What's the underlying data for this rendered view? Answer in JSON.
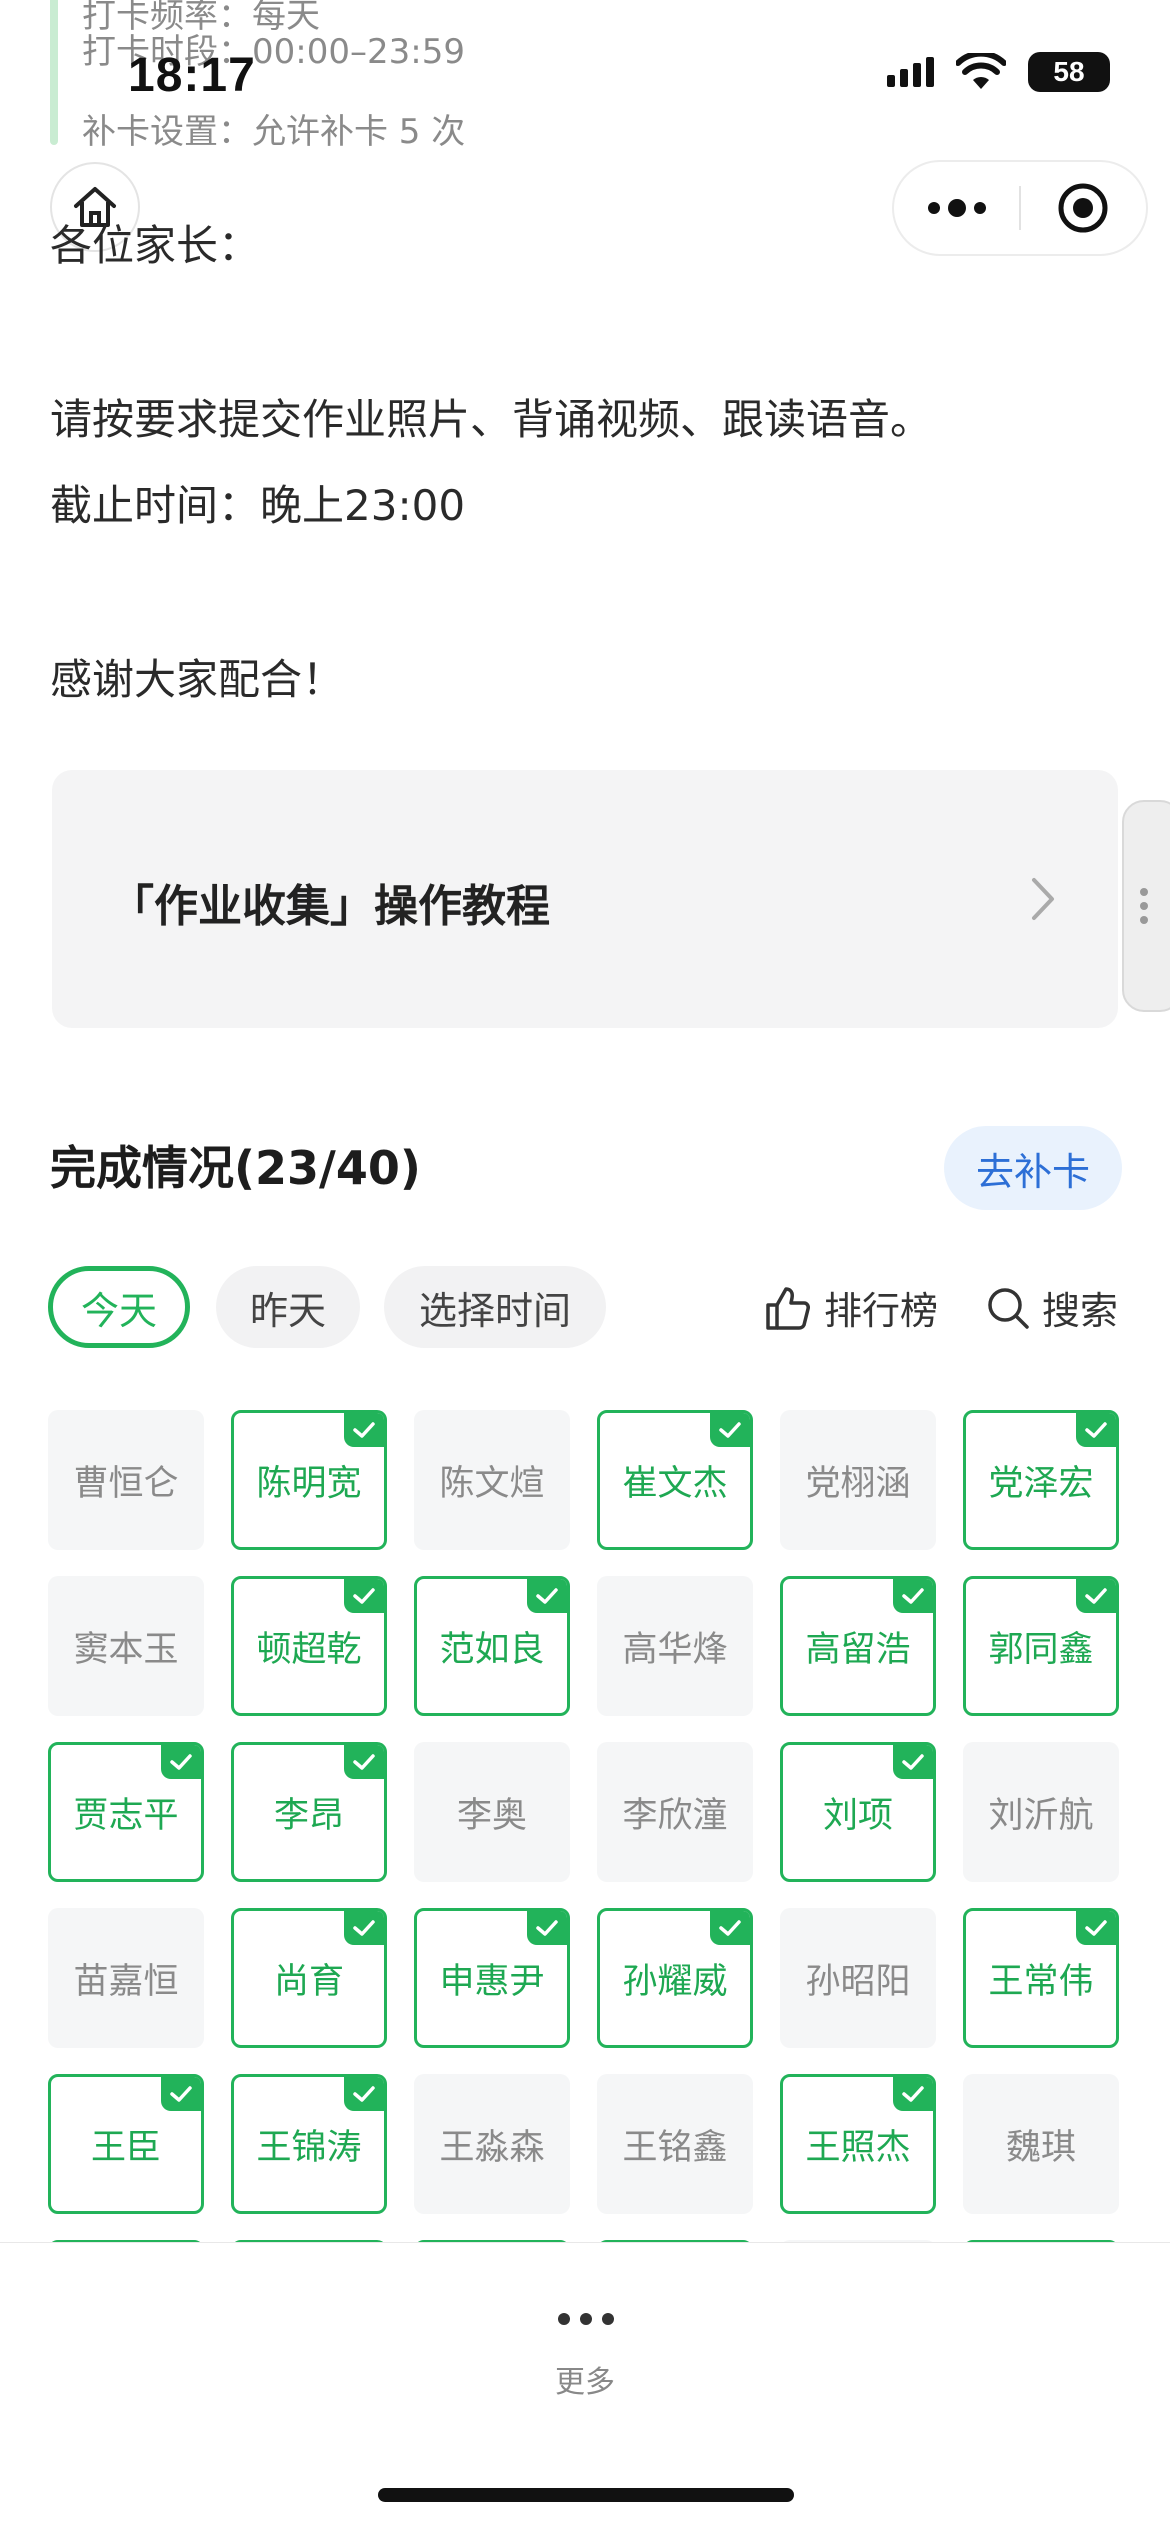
{
  "info": {
    "line1": "打卡频率：每天",
    "line2": "打卡时段：00:00–23:59",
    "line3": "补卡设置：允许补卡 5 次"
  },
  "status_bar": {
    "time": "18:17",
    "battery": "58"
  },
  "content": {
    "greeting": "各位家长：",
    "instruction": "请按要求提交作业照片、背诵视频、跟读语音。",
    "deadline": "截止时间：晚上23:00",
    "thanks": "感谢大家配合！"
  },
  "tutorial": {
    "title": "「作业收集」操作教程"
  },
  "completion": {
    "title": "完成情况(23/40)",
    "makeup_button": "去补卡"
  },
  "filters": {
    "today": "今天",
    "yesterday": "昨天",
    "choose_time": "选择时间"
  },
  "tools": {
    "ranking": "排行榜",
    "search": "搜索"
  },
  "students": [
    {
      "name": "曹恒仑",
      "done": false
    },
    {
      "name": "陈明宽",
      "done": true
    },
    {
      "name": "陈文煊",
      "done": false
    },
    {
      "name": "崔文杰",
      "done": true
    },
    {
      "name": "党栩涵",
      "done": false
    },
    {
      "name": "党泽宏",
      "done": true
    },
    {
      "name": "窦本玉",
      "done": false
    },
    {
      "name": "顿超乾",
      "done": true
    },
    {
      "name": "范如良",
      "done": true
    },
    {
      "name": "高华烽",
      "done": false
    },
    {
      "name": "高留浩",
      "done": true
    },
    {
      "name": "郭同鑫",
      "done": true
    },
    {
      "name": "贾志平",
      "done": true
    },
    {
      "name": "李昂",
      "done": true
    },
    {
      "name": "李奥",
      "done": false
    },
    {
      "name": "李欣潼",
      "done": false
    },
    {
      "name": "刘项",
      "done": true
    },
    {
      "name": "刘沂航",
      "done": false
    },
    {
      "name": "苗嘉恒",
      "done": false
    },
    {
      "name": "尚育",
      "done": true
    },
    {
      "name": "申惠尹",
      "done": true
    },
    {
      "name": "孙耀威",
      "done": true
    },
    {
      "name": "孙昭阳",
      "done": false
    },
    {
      "name": "王常伟",
      "done": true
    },
    {
      "name": "王臣",
      "done": true
    },
    {
      "name": "王锦涛",
      "done": true
    },
    {
      "name": "王淼森",
      "done": false
    },
    {
      "name": "王铭鑫",
      "done": false
    },
    {
      "name": "王照杰",
      "done": true
    },
    {
      "name": "魏琪",
      "done": false
    }
  ],
  "colors": {
    "accent_green": "#22b35a",
    "makeup_blue": "#2d6fd6"
  },
  "bottom_bar": {
    "more_label": "更多"
  }
}
